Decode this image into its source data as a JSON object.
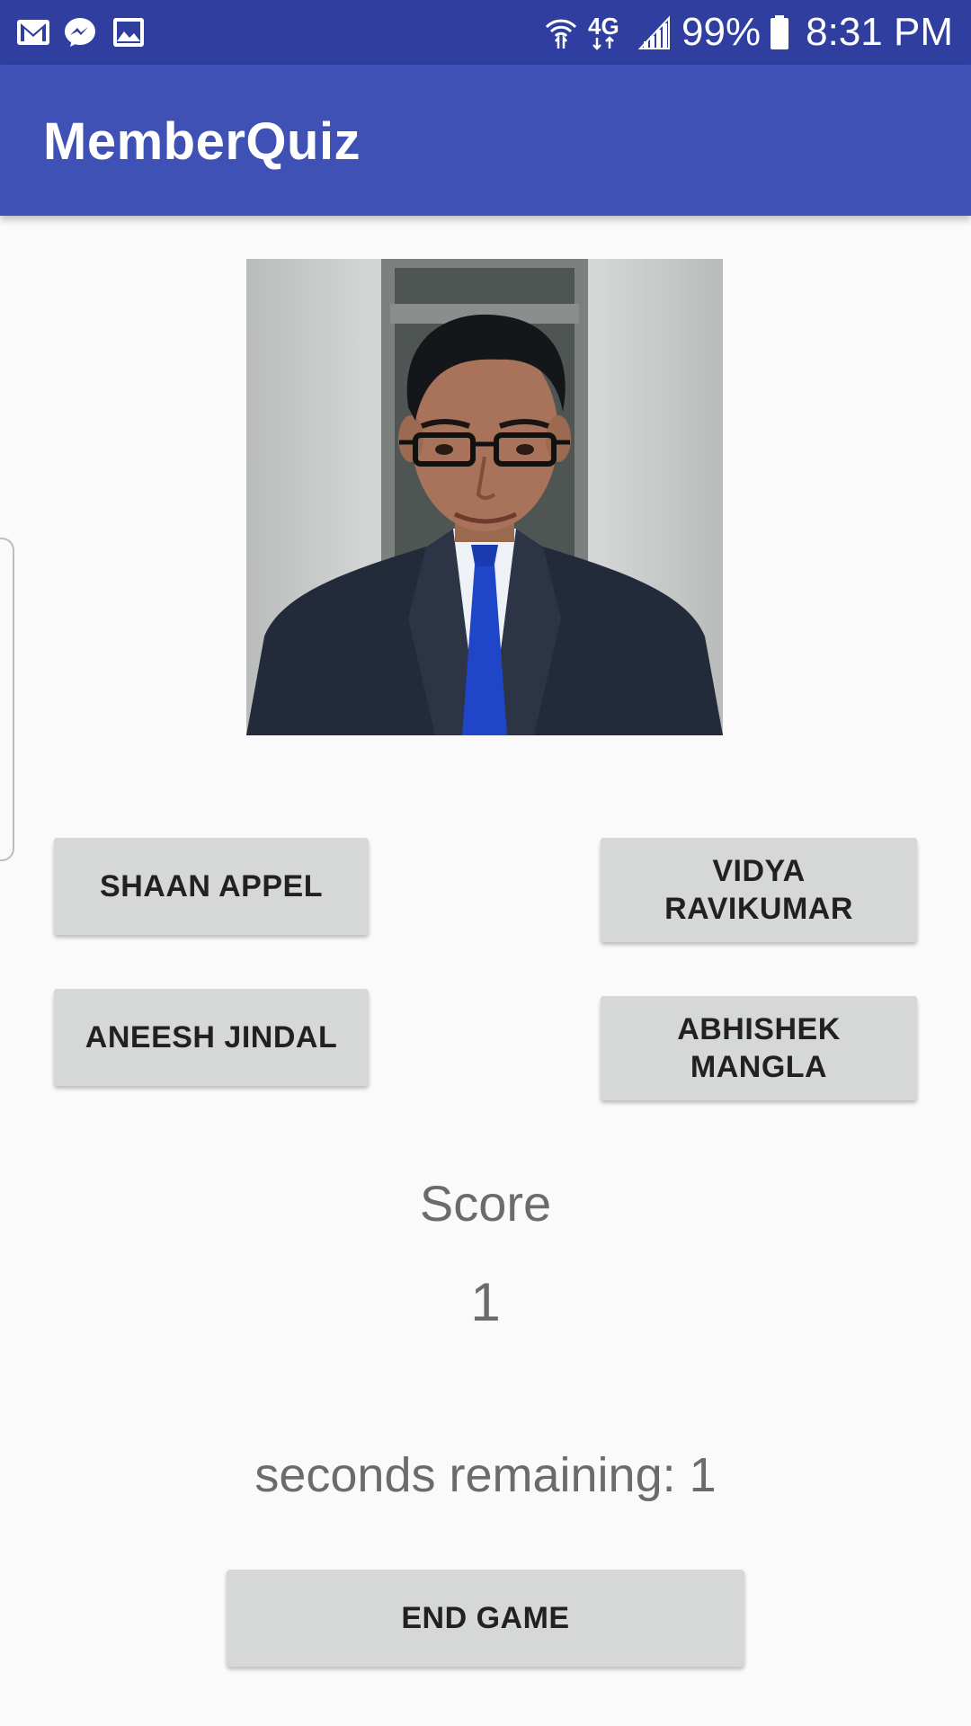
{
  "status_bar": {
    "icons_left": [
      "gmail-icon",
      "messenger-icon",
      "gallery-icon"
    ],
    "icons_right": [
      "wifi-icon",
      "4g-lte-icon",
      "signal-icon",
      "battery-icon"
    ],
    "network": "4G",
    "battery": "99%",
    "time": "8:31 PM"
  },
  "app_bar": {
    "title": "MemberQuiz"
  },
  "quiz": {
    "photo": "member-photo",
    "choices": [
      "SHAAN APPEL",
      "VIDYA RAVIKUMAR",
      "ANEESH JINDAL",
      "ABHISHEK MANGLA"
    ],
    "score_label": "Score",
    "score_value": "1",
    "timer_text": "seconds remaining: 1",
    "end_game_label": "END GAME"
  },
  "colors": {
    "status_bar": "#303f9f",
    "app_bar": "#3f51b5",
    "button": "#d6d7d7",
    "background": "#fafafa"
  }
}
